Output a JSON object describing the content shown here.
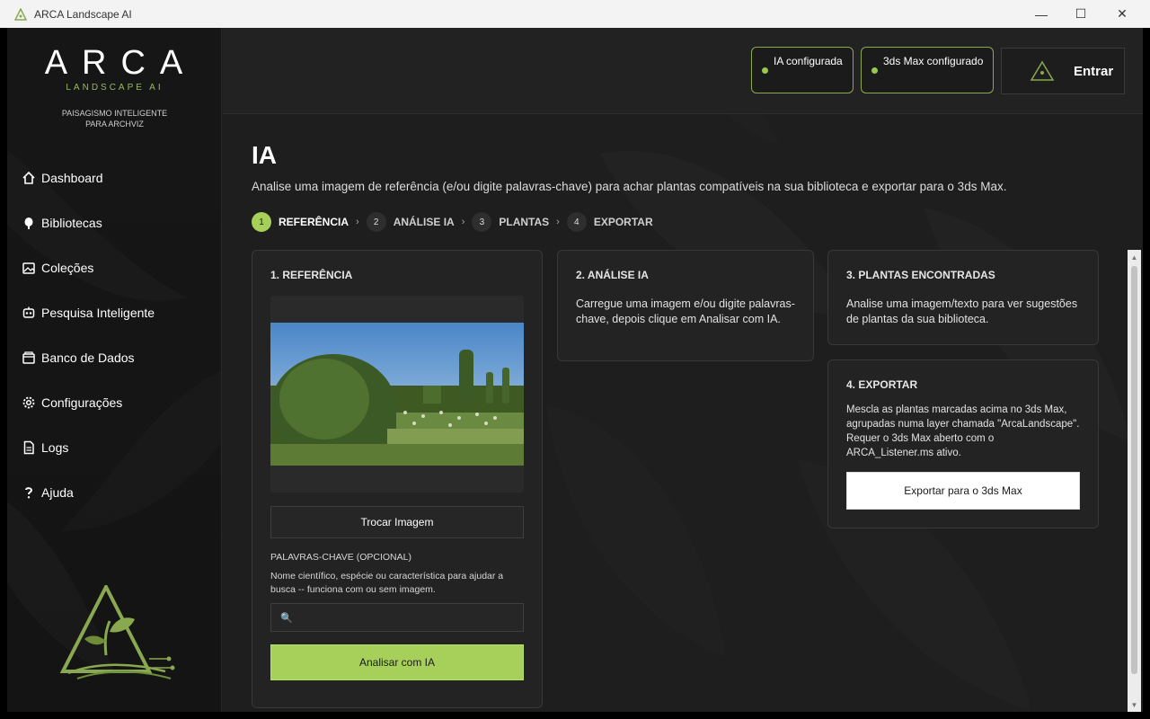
{
  "window": {
    "title": "ARCA Landscape AI",
    "minimize": "—",
    "maximize": "☐",
    "close": "✕"
  },
  "sidebar": {
    "logo": "ARCA",
    "logo_sub": "LANDSCAPE AI",
    "tagline_line1": "PAISAGISMO INTELIGENTE",
    "tagline_line2": "PARA ARCHVIZ",
    "items": [
      {
        "label": "Dashboard",
        "icon": "home-icon"
      },
      {
        "label": "Bibliotecas",
        "icon": "tree-icon"
      },
      {
        "label": "Coleções",
        "icon": "gallery-icon"
      },
      {
        "label": "Pesquisa Inteligente",
        "icon": "robot-icon"
      },
      {
        "label": "Banco de Dados",
        "icon": "database-icon"
      },
      {
        "label": "Configurações",
        "icon": "gear-icon"
      },
      {
        "label": "Logs",
        "icon": "document-icon"
      },
      {
        "label": "Ajuda",
        "icon": "question-icon"
      }
    ]
  },
  "topbar": {
    "status_ia": "IA configurada",
    "status_max": "3ds Max configurado",
    "login": "Entrar"
  },
  "page": {
    "title": "IA",
    "description": "Analise uma imagem de referência (e/ou digite palavras-chave) para achar plantas compatíveis na sua biblioteca e exportar para o 3ds Max."
  },
  "steps": [
    {
      "num": "1",
      "label": "REFERÊNCIA",
      "active": true
    },
    {
      "num": "2",
      "label": "ANÁLISE IA",
      "active": false
    },
    {
      "num": "3",
      "label": "PLANTAS",
      "active": false
    },
    {
      "num": "4",
      "label": "EXPORTAR",
      "active": false
    }
  ],
  "step_separator": "›",
  "reference": {
    "title": "1. REFERÊNCIA",
    "swap_button": "Trocar Imagem",
    "keywords_label": "PALAVRAS-CHAVE (OPCIONAL)",
    "keywords_help": "Nome científico, espécie ou característica para ajudar a busca -- funciona com ou sem imagem.",
    "keywords_value": "",
    "search_icon": "🔍",
    "analyze_button": "Analisar com IA"
  },
  "analysis": {
    "title": "2. ANÁLISE IA",
    "text": "Carregue uma imagem e/ou digite palavras-chave, depois clique em Analisar com IA."
  },
  "plants": {
    "title": "3. PLANTAS ENCONTRADAS",
    "text": "Analise uma imagem/texto para ver sugestões de plantas da sua biblioteca."
  },
  "export": {
    "title": "4. EXPORTAR",
    "text": "Mescla as plantas marcadas acima no 3ds Max, agrupadas numa layer chamada \"ArcaLandscape\". Requer o 3ds Max aberto com o ARCA_Listener.ms ativo.",
    "button": "Exportar para o 3ds Max"
  },
  "colors": {
    "accent": "#a6d05a",
    "brand_green": "#9ab85e",
    "background": "#1e1e1e"
  }
}
